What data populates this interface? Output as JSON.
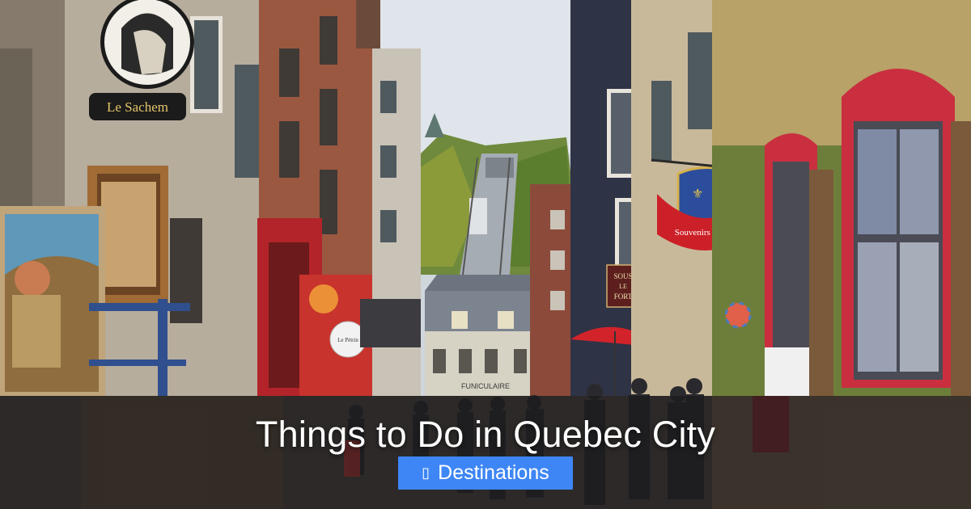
{
  "headline": "Things to Do in Quebec City",
  "category": {
    "label": "Destinations",
    "icon": "folder-icon",
    "icon_glyph": "▯",
    "color": "#3e86f5"
  },
  "photo": {
    "signs": {
      "le_sachem": "Le Sachem",
      "souvenirs": "Souvenirs du Lys",
      "sous_le_fort_line1": "SOUS",
      "sous_le_fort_line2": "LE",
      "sous_le_fort_line3": "FORT",
      "funiculaire": "FUNICULAIRE",
      "round_sign": "Le Pétrin"
    }
  }
}
